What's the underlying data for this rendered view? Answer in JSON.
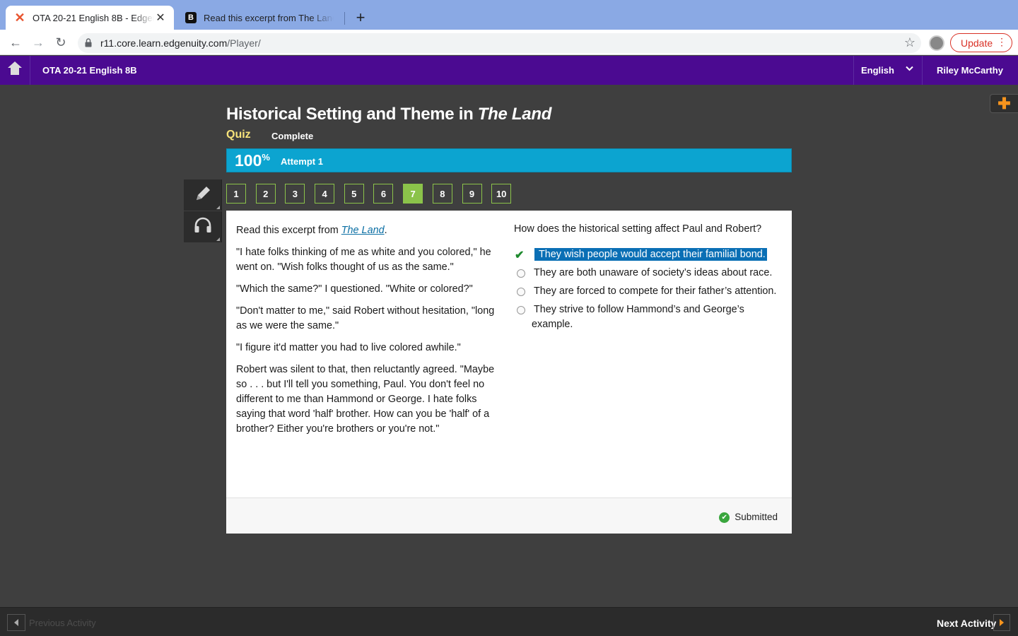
{
  "browser": {
    "tabs": [
      {
        "title": "OTA 20-21 English 8B - Edgenuity",
        "favicon": "edgenuity-x-icon",
        "active": true
      },
      {
        "title": "Read this excerpt from The Land",
        "favicon": "brainly-b-icon",
        "active": false
      }
    ],
    "new_tab": "+",
    "url_host": "r11.core.learn.edgenuity.com",
    "url_path": "/Player/",
    "update_label": "Update"
  },
  "header": {
    "course": "OTA 20-21 English 8B",
    "language": "English",
    "user": "Riley McCarthy"
  },
  "lesson": {
    "title_prefix": "Historical Setting and Theme in ",
    "title_italic": "The Land",
    "type": "Quiz",
    "status": "Complete",
    "score": "100",
    "score_unit": "%",
    "attempt": "Attempt 1"
  },
  "question_nav": {
    "items": [
      "1",
      "2",
      "3",
      "4",
      "5",
      "6",
      "7",
      "8",
      "9",
      "10"
    ],
    "current": "7",
    "accent": "#8bc34a"
  },
  "passage": {
    "intro_prefix": "Read this excerpt from ",
    "intro_link": "The Land",
    "intro_suffix": ".",
    "paragraphs": [
      "\"I hate folks thinking of me as white and you colored,\" he went on. \"Wish folks thought of us as the same.\"",
      "\"Which the same?\" I questioned. \"White or colored?\"",
      "\"Don't matter to me,\" said Robert without hesitation, \"long as we were the same.\"",
      "\"I figure it'd matter you had to live colored awhile.\"",
      "Robert was silent to that, then reluctantly agreed. \"Maybe so . . . but I'll tell you something, Paul. You don't feel no different to me than Hammond or George. I hate folks saying that word 'half' brother. How can you be 'half' of a brother? Either you're brothers or you're not.\""
    ]
  },
  "question": {
    "prompt": "How does the historical setting affect Paul and Robert?",
    "answers": [
      {
        "text": "They wish people would accept their familial bond.",
        "selected": true,
        "correct": true
      },
      {
        "text": "They are both unaware of society’s ideas about race.",
        "selected": false
      },
      {
        "text": "They are forced to compete for their father’s attention.",
        "selected": false
      },
      {
        "text": "They strive to follow Hammond’s and George’s example.",
        "selected": false
      }
    ]
  },
  "footer": {
    "status": "Submitted"
  },
  "bottom_nav": {
    "previous": "Previous Activity",
    "next": "Next Activity"
  },
  "colors": {
    "appbar": "#4b0a91",
    "progress": "#0ca4d0",
    "quiz_label": "#f7e37a",
    "selected_answer": "#0a6fb5",
    "next_arrow": "#f7941d"
  }
}
